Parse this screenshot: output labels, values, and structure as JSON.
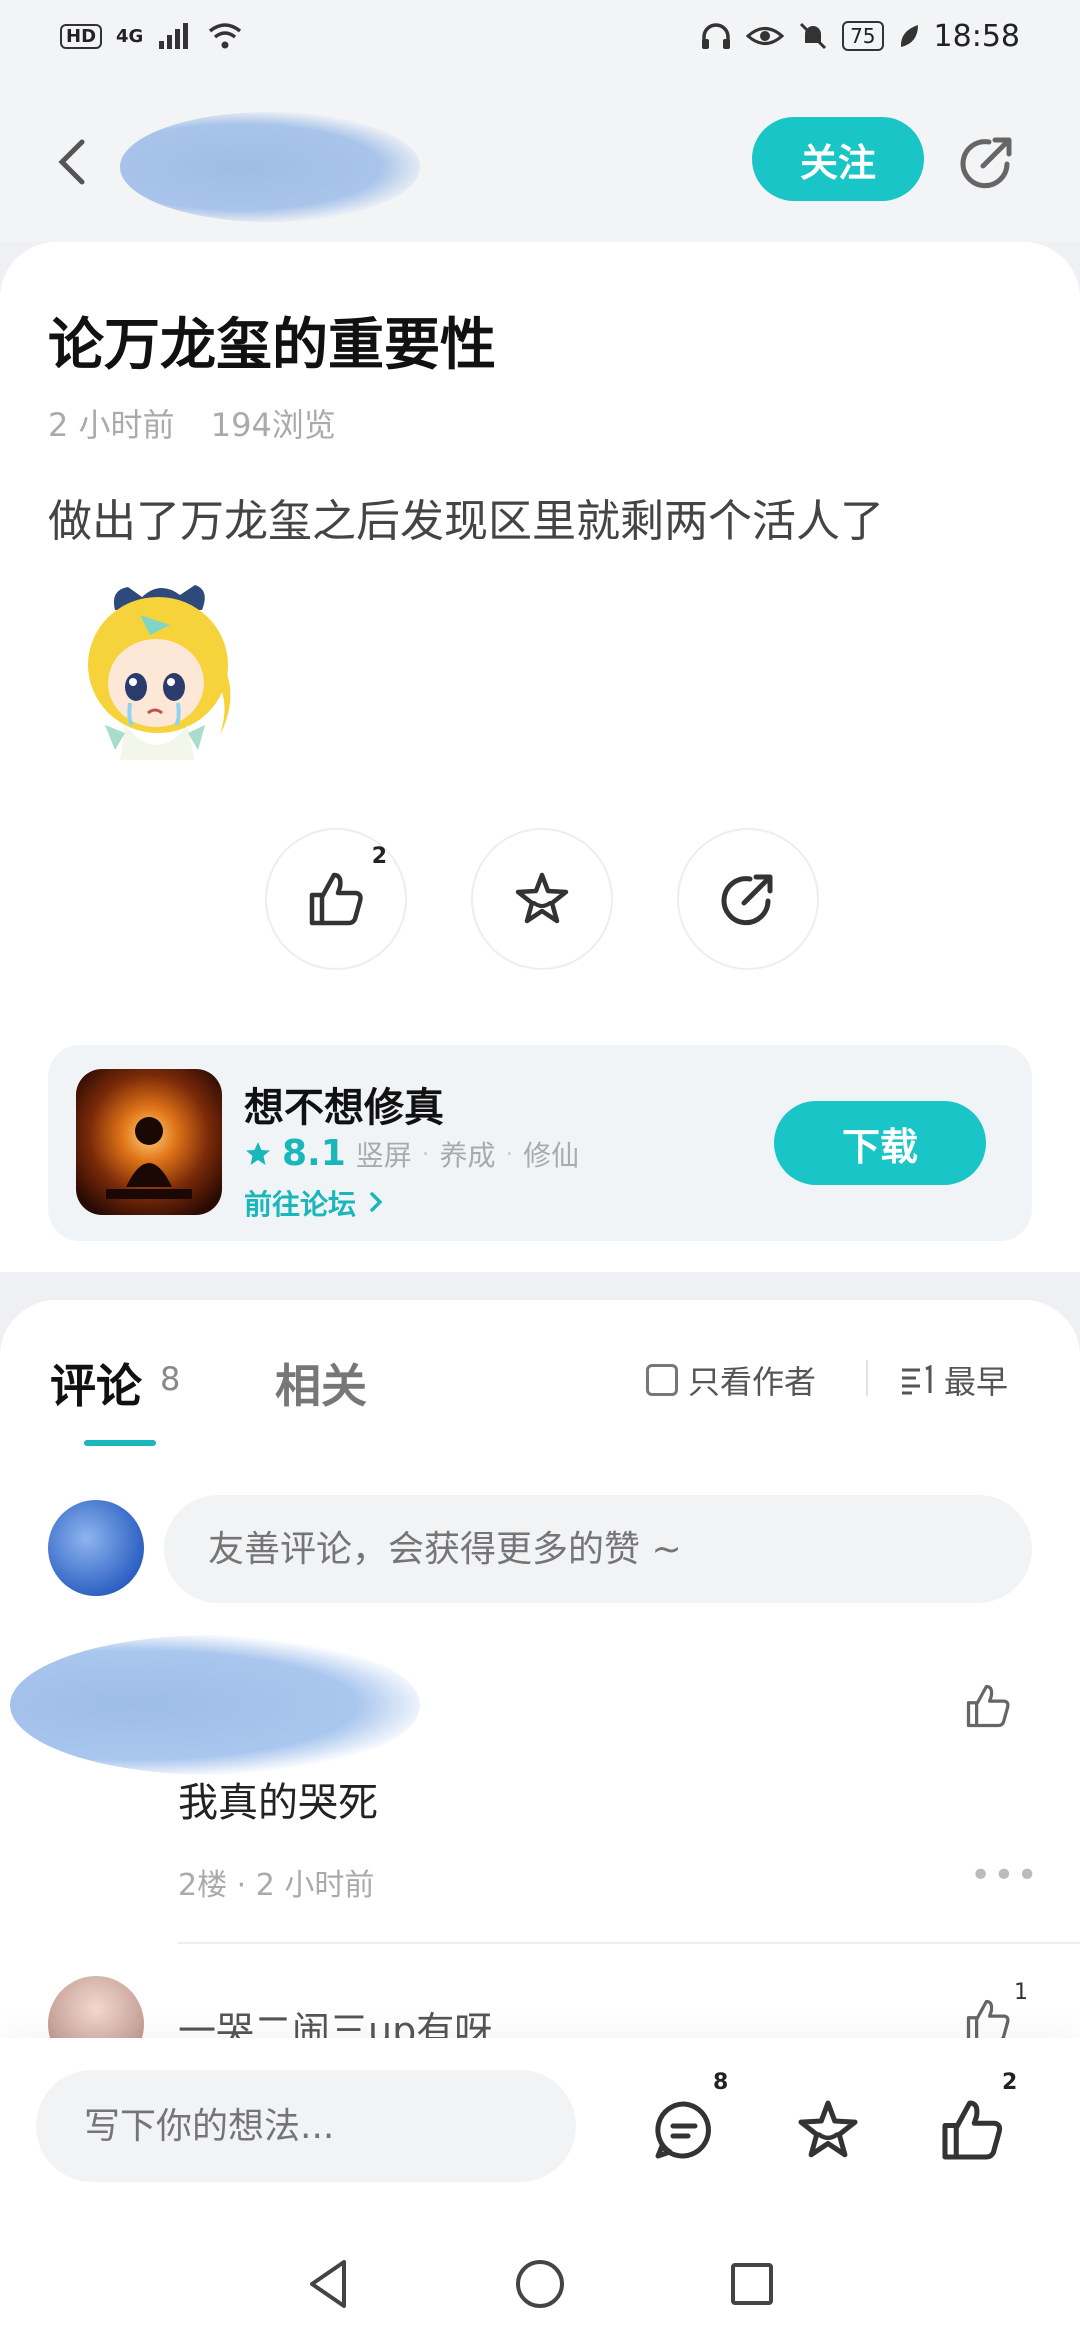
{
  "status_bar": {
    "left_badges": [
      "HD",
      "4G"
    ],
    "battery": "75",
    "time": "18:58"
  },
  "header": {
    "follow_label": "关注"
  },
  "post": {
    "title": "论万龙玺的重要性",
    "time_ago": "2 小时前",
    "views": "194浏览",
    "content": "做出了万龙玺之后发现区里就剩两个活人了",
    "like_count": "2"
  },
  "app_card": {
    "name": "想不想修真",
    "rating": "8.1",
    "tags": [
      "竖屏",
      "养成",
      "修仙"
    ],
    "forum_link": "前往论坛",
    "download_label": "下载"
  },
  "comments_section": {
    "tab_comments": "评论",
    "comment_count": "8",
    "tab_related": "相关",
    "only_author": "只看作者",
    "sort_label": "最早",
    "input_placeholder": "友善评论，会获得更多的赞 ~",
    "items": [
      {
        "text": "我真的哭死",
        "meta": "2楼 · 2 小时前"
      },
      {
        "name": "一哭二闹三up有呀",
        "like_count": "1"
      }
    ]
  },
  "bottom_bar": {
    "placeholder": "写下你的想法...",
    "comment_count": "8",
    "like_count": "2"
  },
  "colors": {
    "accent": "#19c5c7",
    "accent_text": "#19b7b9"
  }
}
